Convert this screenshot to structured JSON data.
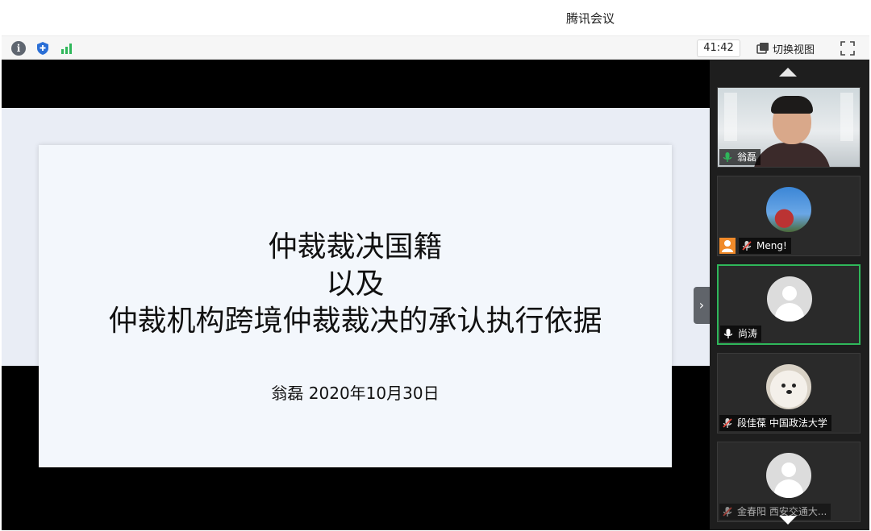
{
  "window": {
    "title": "腾讯会议"
  },
  "toolbar": {
    "info_icon": "info-icon",
    "security_icon": "shield-icon",
    "signal_icon": "signal-icon",
    "timer": "41:42",
    "switch_view_label": "切换视图",
    "fullscreen_icon": "fullscreen-icon"
  },
  "slide": {
    "title_lines": [
      "仲裁裁决国籍",
      "以及",
      "仲裁机构跨境仲裁裁决的承认执行依据"
    ],
    "subtitle": "翁磊 2020年10月30日"
  },
  "participants": [
    {
      "name": "翁磊",
      "mic": "on",
      "has_video": true
    },
    {
      "name": "Meng!",
      "mic": "muted",
      "host": true
    },
    {
      "name": "尚涛",
      "mic": "on",
      "active_speaker": true
    },
    {
      "name": "段佳葆 中国政法大学",
      "mic": "muted"
    },
    {
      "name": "金春阳 西安交通大...",
      "mic": "muted"
    }
  ],
  "colors": {
    "active_border": "#2fb75a",
    "mic_on": "#2fb75a",
    "mic_muted": "#e0453a",
    "host_badge": "#f08a2a"
  }
}
